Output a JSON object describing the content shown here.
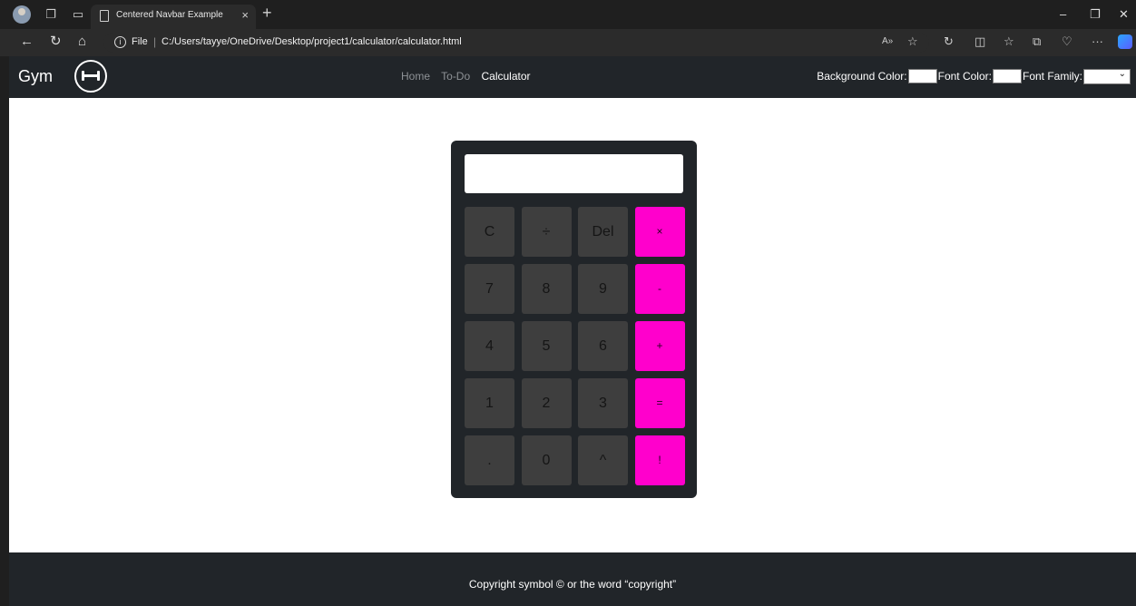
{
  "browser": {
    "tab_title": "Centered Navbar Example",
    "address_scheme": "File",
    "address_path": "C:/Users/tayye/OneDrive/Desktop/project1/calculator/calculator.html"
  },
  "navbar": {
    "brand": "Gym",
    "links": [
      {
        "label": "Home",
        "active": false
      },
      {
        "label": "To-Do",
        "active": false
      },
      {
        "label": "Calculator",
        "active": true
      }
    ],
    "bg_color_label": "Background Color:",
    "font_color_label": "Font Color:",
    "font_family_label": "Font Family:"
  },
  "calculator": {
    "display_value": "",
    "keys": [
      [
        "C",
        "÷",
        "Del",
        "×"
      ],
      [
        "7",
        "8",
        "9",
        "-"
      ],
      [
        "4",
        "5",
        "6",
        "+"
      ],
      [
        "1",
        "2",
        "3",
        "="
      ],
      [
        ".",
        "0",
        "^",
        "!"
      ]
    ],
    "colors": {
      "body": "#212529",
      "key": "#3e3e3e",
      "operator": "#ff00cc"
    }
  },
  "footer": {
    "text": "Copyright symbol © or the word “copyright”"
  }
}
